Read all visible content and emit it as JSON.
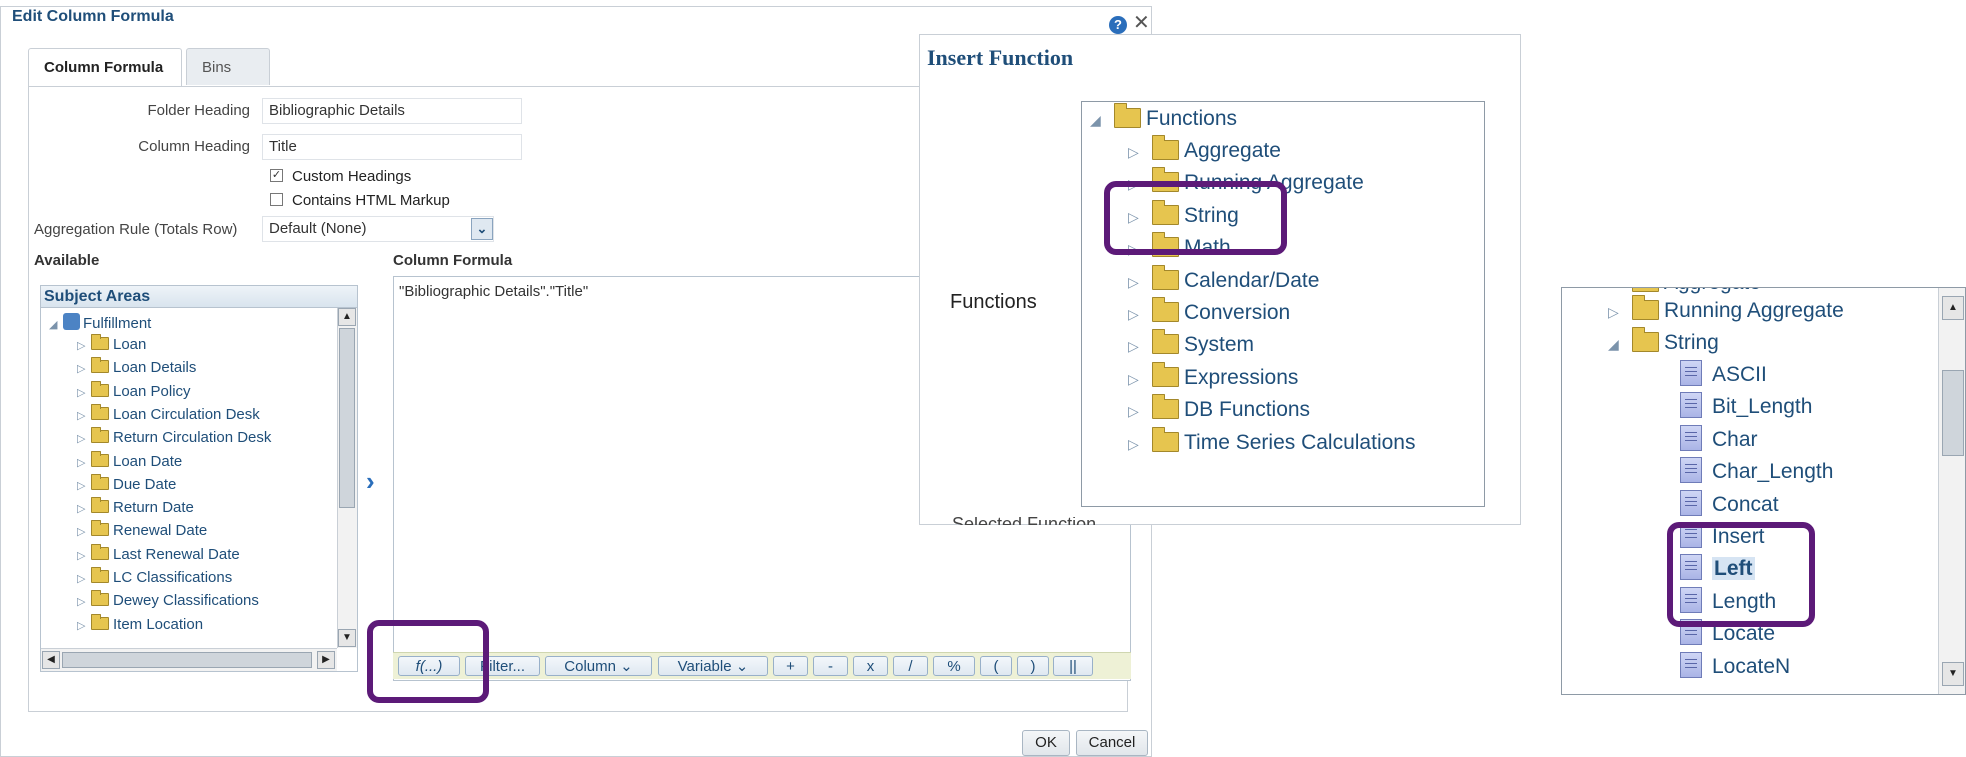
{
  "dialog": {
    "title": "Edit Column Formula",
    "help_icon": "?",
    "close_icon": "✕",
    "tabs": [
      "Column Formula",
      "Bins"
    ],
    "folder_heading_label": "Folder Heading",
    "folder_heading_value": "Bibliographic Details",
    "column_heading_label": "Column Heading",
    "column_heading_value": "Title",
    "custom_headings_label": "Custom Headings",
    "custom_headings_checked": true,
    "contains_html_label": "Contains HTML Markup",
    "contains_html_checked": false,
    "aggregation_label": "Aggregation Rule (Totals Row)",
    "aggregation_value": "Default (None)",
    "available_label": "Available",
    "formula_label": "Column Formula",
    "formula_text": "\"Bibliographic Details\".\"Title\"",
    "subject_areas_header": "Subject Areas",
    "subject_root": "Fulfillment",
    "subject_items": [
      "Loan",
      "Loan Details",
      "Loan Policy",
      "Loan Circulation Desk",
      "Return Circulation Desk",
      "Loan Date",
      "Due Date",
      "Return Date",
      "Renewal Date",
      "Last Renewal Date",
      "LC Classifications",
      "Dewey Classifications",
      "Item Location"
    ],
    "formula_buttons": [
      "f(...)",
      "Filter...",
      "Column ⌄",
      "Variable ⌄",
      "+",
      "-",
      "x",
      "/",
      "%",
      "(",
      ")",
      "||"
    ],
    "ok_label": "OK",
    "cancel_label": "Cancel"
  },
  "insert_function": {
    "title": "Insert Function",
    "functions_label": "Functions",
    "tree_root": "Functions",
    "categories": [
      "Aggregate",
      "Running Aggregate",
      "String",
      "Math",
      "Calendar/Date",
      "Conversion",
      "System",
      "Expressions",
      "DB Functions",
      "Time Series Calculations"
    ],
    "cut_off_text": "Selected Function"
  },
  "string_functions": {
    "partial_top": "Aggregate",
    "running_aggregate": "Running Aggregate",
    "string_folder": "String",
    "items": [
      "ASCII",
      "Bit_Length",
      "Char",
      "Char_Length",
      "Concat",
      "Insert",
      "Left",
      "Length",
      "Locate",
      "LocateN"
    ],
    "selected": "Left"
  },
  "colors": {
    "highlight": "#5c1a78",
    "link": "#1f4e79",
    "accent": "#2a6ebb"
  }
}
